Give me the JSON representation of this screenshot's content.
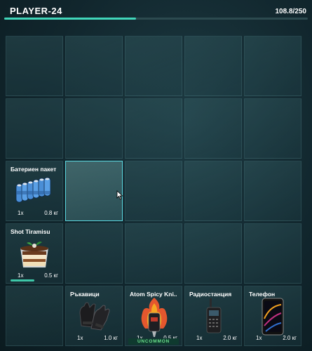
{
  "header": {
    "player_name": "PLAYER-24",
    "weight": "108.8/250",
    "weight_fraction": 0.435,
    "accent": "#41d6ba"
  },
  "items": {
    "batteries": {
      "name": "Батериен пакет",
      "qty": "1x",
      "weight": "0.8 кг",
      "icon": "battery-pack-icon"
    },
    "tiramisu": {
      "name": "Shot Tiramisu",
      "qty": "1x",
      "weight": "0.5 кг",
      "icon": "tiramisu-icon"
    },
    "gloves": {
      "name": "Ръкавици",
      "qty": "1x",
      "weight": "1.0 кг",
      "icon": "gloves-icon"
    },
    "knife": {
      "name": "Atom Spicy Kni..",
      "qty": "1x",
      "weight": "0.5 кг",
      "rarity": "UNCOMMON",
      "icon": "spicy-knife-icon"
    },
    "radio": {
      "name": "Радиостанция",
      "qty": "1x",
      "weight": "2.0 кг",
      "icon": "radio-icon"
    },
    "phone": {
      "name": "Телефон",
      "qty": "1x",
      "weight": "2.0 кг",
      "icon": "phone-icon"
    }
  }
}
